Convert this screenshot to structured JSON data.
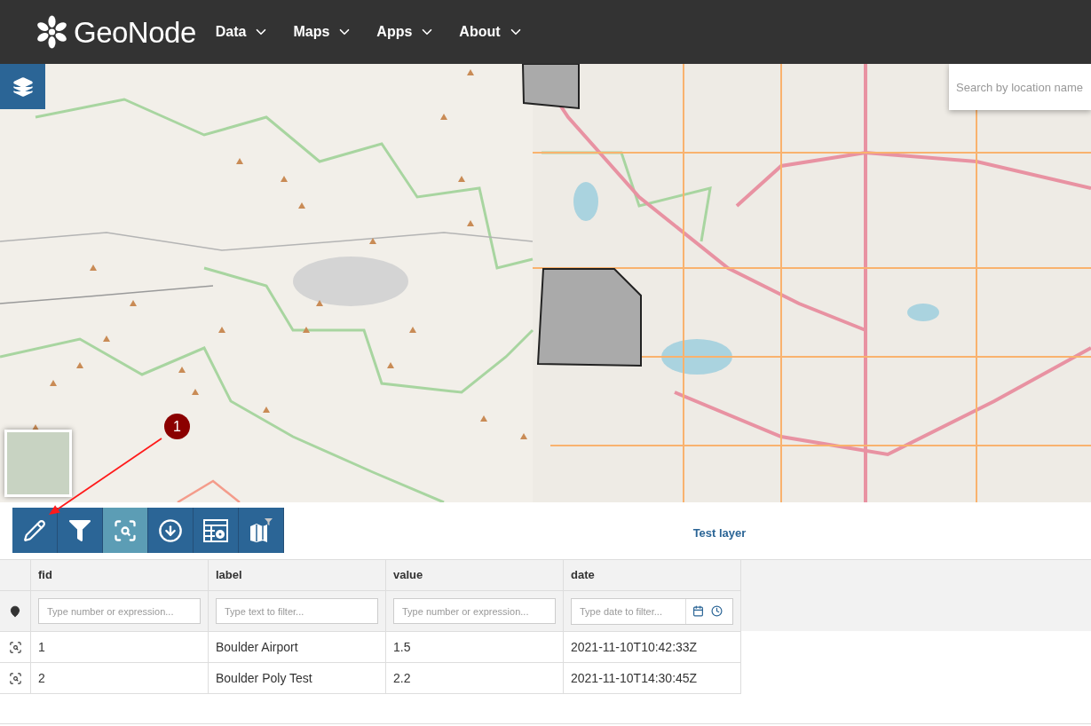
{
  "navbar": {
    "logo": "GeoNode",
    "menus": [
      {
        "label": "Data"
      },
      {
        "label": "Maps"
      },
      {
        "label": "Apps"
      },
      {
        "label": "About"
      }
    ]
  },
  "map": {
    "search": {
      "placeholder": "Search by location name"
    },
    "annotation": {
      "label": "1"
    }
  },
  "feature_grid": {
    "toolbar": [
      {
        "kind": "edit",
        "selected": false
      },
      {
        "kind": "filter",
        "selected": false
      },
      {
        "kind": "zoom",
        "selected": true
      },
      {
        "kind": "download",
        "selected": false
      },
      {
        "kind": "settings",
        "selected": false
      },
      {
        "kind": "map-filter",
        "selected": false
      }
    ],
    "title": "Test layer",
    "columns": [
      {
        "name": "fid",
        "kind": "text",
        "placeholder": "Type number or expression..."
      },
      {
        "name": "label",
        "kind": "text",
        "placeholder": "Type text to filter..."
      },
      {
        "name": "value",
        "kind": "text",
        "placeholder": "Type number or expression..."
      },
      {
        "name": "date",
        "kind": "date",
        "placeholder": "Type date to filter..."
      }
    ],
    "rows": [
      {
        "cells": [
          "1",
          "Boulder Airport",
          "1.5",
          "2021-11-10T10:42:33Z"
        ]
      },
      {
        "cells": [
          "2",
          "Boulder Poly Test",
          "2.2",
          "2021-11-10T14:30:45Z"
        ]
      }
    ]
  }
}
